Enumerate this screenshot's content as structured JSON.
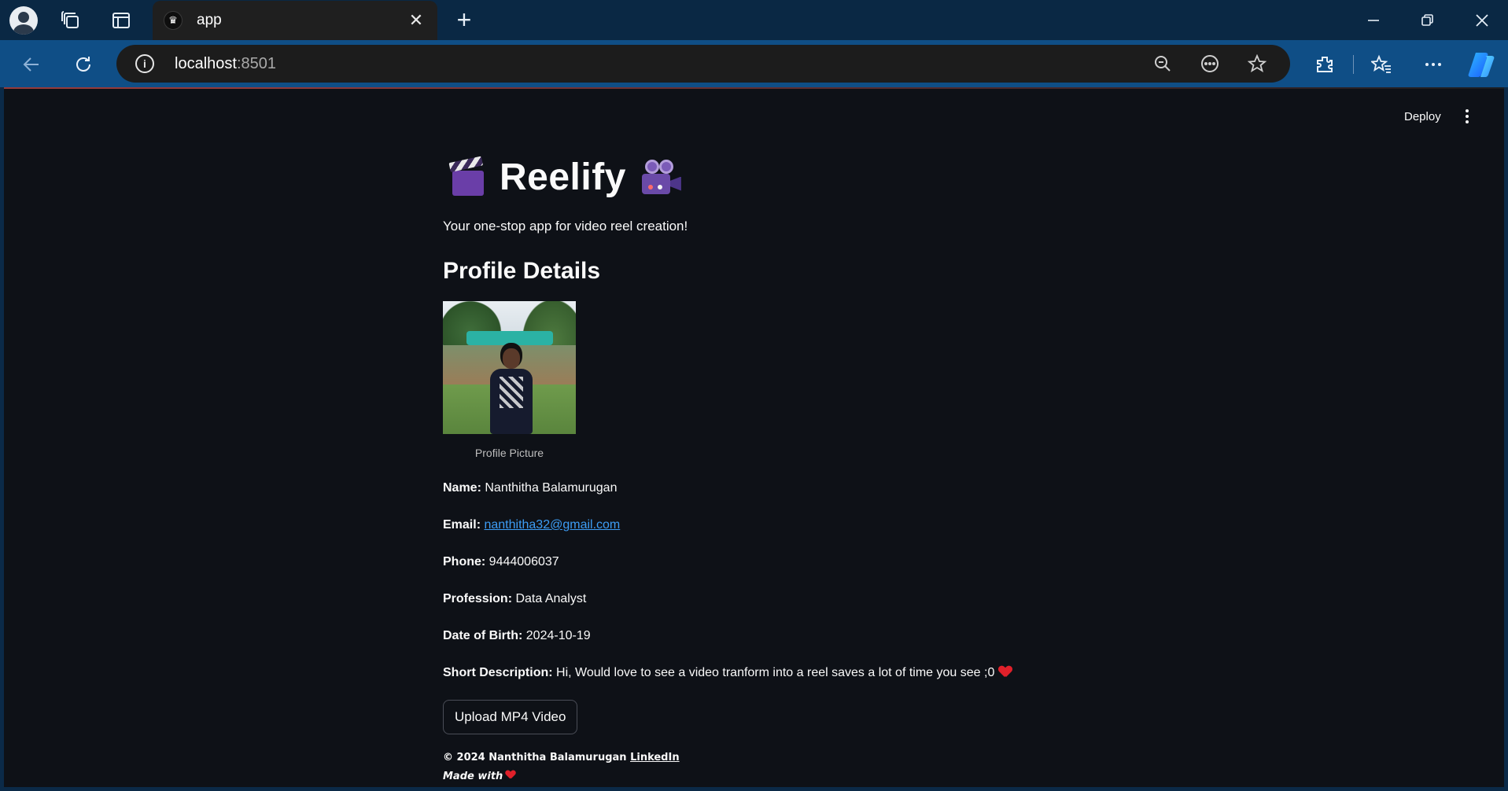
{
  "browser": {
    "tab_title": "app",
    "tab_favicon_glyph": "♛",
    "new_tab_glyph": "+",
    "close_glyph": "✕",
    "url_host": "localhost",
    "url_port": ":8501",
    "icons": {
      "profile": "profile-avatar-icon",
      "workspaces": "workspaces-icon",
      "tab_actions": "tab-actions-icon",
      "back": "back-arrow-icon",
      "refresh": "refresh-icon",
      "info": "site-info-icon",
      "zoom_out": "zoom-out-icon",
      "read_aloud": "more-tools-icon",
      "favorite": "star-icon",
      "extensions": "extensions-icon",
      "favorites": "favorites-icon",
      "settings": "ellipsis-icon",
      "copilot": "copilot-icon"
    }
  },
  "app_toolbar": {
    "deploy_label": "Deploy"
  },
  "app": {
    "title": "Reelify",
    "subtitle": "Your one-stop app for video reel creation!",
    "section_heading": "Profile Details",
    "photo_caption": "Profile Picture",
    "fields": {
      "name_label": "Name:",
      "name_value": "Nanthitha Balamurugan",
      "email_label": "Email:",
      "email_value": "nanthitha32@gmail.com",
      "phone_label": "Phone:",
      "phone_value": "9444006037",
      "profession_label": "Profession:",
      "profession_value": "Data Analyst",
      "dob_label": "Date of Birth:",
      "dob_value": "2024-10-19",
      "desc_label": "Short Description:",
      "desc_value": "Hi, Would love to see a video tranform into a reel saves a lot of time you see ;0"
    },
    "upload_button_label": "Upload MP4 Video",
    "footer": {
      "copyright": "© 2024 Nanthitha Balamurugan",
      "linkedin_label": "LinkedIn",
      "made_with": "Made with"
    }
  },
  "colors": {
    "background": "#0e1117",
    "text": "#fafafa",
    "link": "#3d9df5",
    "heart": "#e0202a",
    "tab_bar": "#0a2844",
    "address_bar": "#0f4e86"
  }
}
